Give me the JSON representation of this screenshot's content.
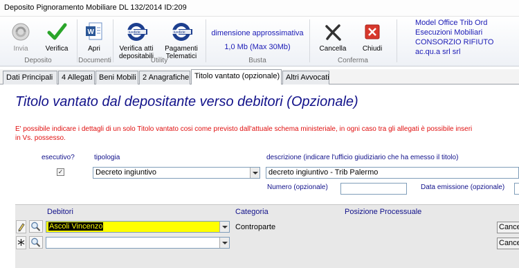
{
  "window": {
    "title": "Deposito Pignoramento Mobiliare DL 132/2014 ID:209"
  },
  "ribbon": {
    "deposito": {
      "label": "Deposito",
      "invia": "Invia",
      "verifica": "Verifica"
    },
    "documenti": {
      "label": "Documenti",
      "apri": "Apri"
    },
    "utility": {
      "label": "Utility",
      "verifica_atti_1": "Verifica atti",
      "verifica_atti_2": "depositabili",
      "pagamenti_1": "Pagamenti",
      "pagamenti_2": "Telematici",
      "logo_text": "iusdizie"
    },
    "busta": {
      "label": "Busta",
      "title": "dimensione approssimativa",
      "size": "1,0 Mb (Max 30Mb)"
    },
    "conferma": {
      "label": "Conferma",
      "cancella": "Cancella",
      "chiudi": "Chiudi"
    },
    "model_info": {
      "line1": "Model Office Trib Ord",
      "line2": "Esecuzioni Mobiliari",
      "line3": "CONSORZIO RIFIUTO",
      "line4": "ac.qu.a srl srl"
    }
  },
  "tabs": [
    "Dati Principali",
    "4 Allegati",
    "Beni Mobili",
    "2 Anagrafiche",
    "Titolo vantato (opzionale)",
    "Altri Avvocati"
  ],
  "active_tab": 4,
  "content": {
    "heading": "Titolo vantato dal depositante verso debitori (Opzionale)",
    "note_line1": "E' possibile indicare i dettagli di un solo Titolo vantato cosi come previsto dall'attuale schema ministeriale, in ogni caso tra gli allegati è possibile inseri",
    "note_line2": "in Vs. possesso.",
    "form": {
      "esecutivo_label": "esecutivo?",
      "esecutivo_checked": true,
      "esecutivo_mark": "✓",
      "tipologia_label": "tipologia",
      "tipologia_value": "Decreto ingiuntivo",
      "descrizione_label": "descrizione (indicare l'ufficio giudiziario che ha emesso il titolo)",
      "descrizione_value": "decreto ingiuntivo -  Trib Palermo",
      "numero_label": "Numero (opzionale)",
      "numero_value": "",
      "data_label": "Data emissione (opzionale)",
      "data_value": ""
    },
    "grid": {
      "headers": {
        "debitori": "Debitori",
        "categoria": "Categoria",
        "posizione": "Posizione Processuale"
      },
      "rows": [
        {
          "debitore": "Ascoli Vincenzo",
          "categoria": "Controparte",
          "cancel": "Cance"
        },
        {
          "debitore": "",
          "categoria": "",
          "cancel": "Cance"
        }
      ]
    }
  },
  "colors": {
    "accent_blue": "#12128a",
    "note_red": "#e01010",
    "highlight_yellow": "#ffff00"
  }
}
